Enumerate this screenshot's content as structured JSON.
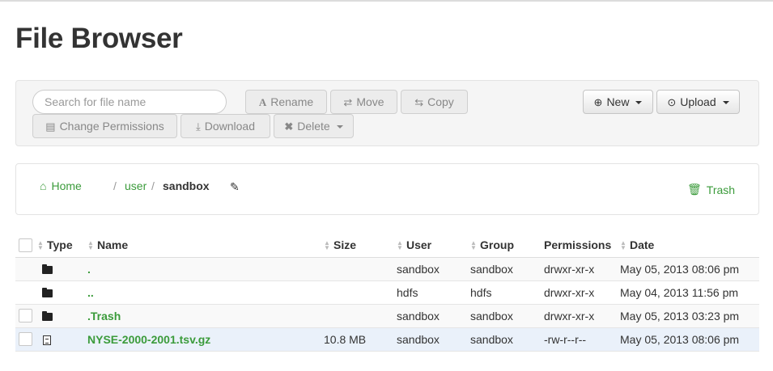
{
  "page": {
    "title": "File Browser"
  },
  "toolbar": {
    "search_placeholder": "Search for file name",
    "rename_label": "Rename",
    "move_label": "Move",
    "copy_label": "Copy",
    "change_permissions_label": "Change Permissions",
    "download_label": "Download",
    "delete_label": "Delete",
    "new_label": "New",
    "upload_label": "Upload"
  },
  "breadcrumb": {
    "home": "Home",
    "separator": "/",
    "user": "user",
    "current": "sandbox",
    "trash": "Trash"
  },
  "table": {
    "columns": {
      "type": "Type",
      "name": "Name",
      "size": "Size",
      "user": "User",
      "group": "Group",
      "permissions": "Permissions",
      "date": "Date"
    },
    "rows": [
      {
        "name": ".",
        "size": "",
        "user": "sandbox",
        "group": "sandbox",
        "permissions": "drwxr-xr-x",
        "date": "May 05, 2013 08:06 pm",
        "icon": "folder-icon"
      },
      {
        "name": "..",
        "size": "",
        "user": "hdfs",
        "group": "hdfs",
        "permissions": "drwxr-xr-x",
        "date": "May 04, 2013 11:56 pm",
        "icon": "folder-icon"
      },
      {
        "name": ".Trash",
        "size": "",
        "user": "sandbox",
        "group": "sandbox",
        "permissions": "drwxr-xr-x",
        "date": "May 05, 2013 03:23 pm",
        "icon": "folder-icon"
      },
      {
        "name": "NYSE-2000-2001.tsv.gz",
        "size": "10.8 MB",
        "user": "sandbox",
        "group": "sandbox",
        "permissions": "-rw-r--r--",
        "date": "May 05, 2013 08:06 pm",
        "icon": "file-icon"
      }
    ]
  },
  "colors": {
    "link_green": "#3b9b3b",
    "highlight_row": "#eaf1fa"
  }
}
